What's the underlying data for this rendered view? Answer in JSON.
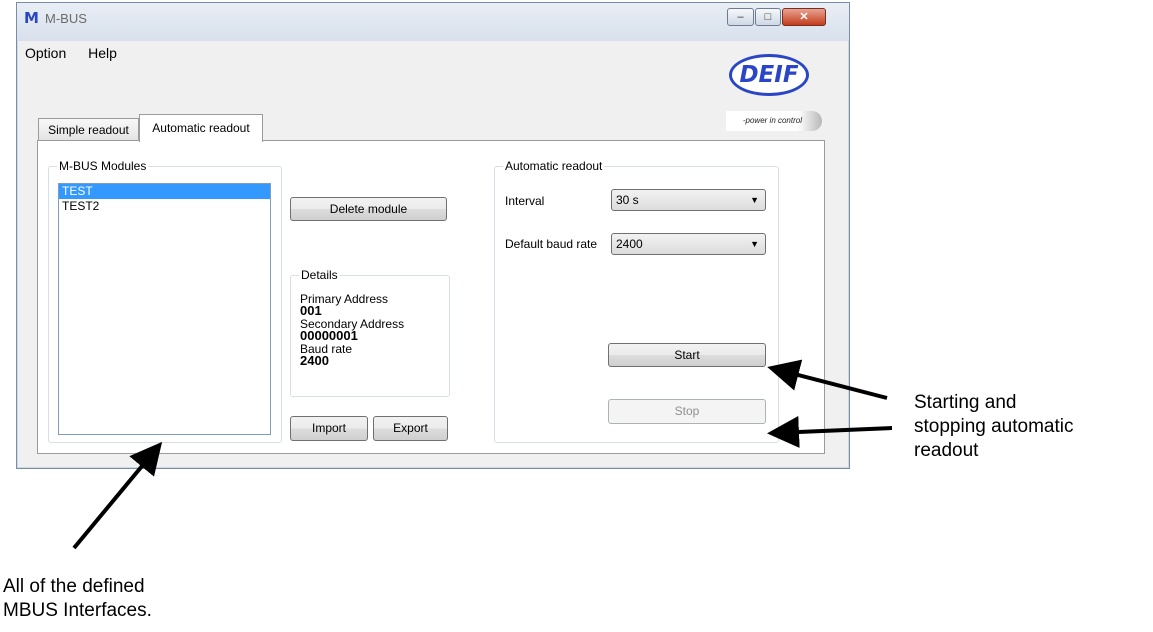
{
  "window": {
    "title": "M-BUS",
    "app_icon": "M",
    "controls": {
      "minimize": "–",
      "maximize": "□",
      "close": "✕"
    }
  },
  "menu": {
    "items": [
      "Option",
      "Help"
    ]
  },
  "logo": {
    "brand": "DEIF",
    "tagline": "-power in control"
  },
  "tabs": [
    {
      "label": "Simple readout",
      "active": false
    },
    {
      "label": "Automatic readout",
      "active": true
    }
  ],
  "modules": {
    "legend": "M-BUS Modules",
    "items": [
      {
        "label": "TEST",
        "selected": true
      },
      {
        "label": "TEST2",
        "selected": false
      }
    ]
  },
  "buttons": {
    "delete_module": "Delete module",
    "import": "Import",
    "export": "Export",
    "start": "Start",
    "stop": "Stop"
  },
  "details": {
    "legend": "Details",
    "primary_address_label": "Primary Address",
    "primary_address_value": "001",
    "secondary_address_label": "Secondary Address",
    "secondary_address_value": "00000001",
    "baud_rate_label": "Baud rate",
    "baud_rate_value": "2400"
  },
  "automatic": {
    "legend": "Automatic readout",
    "interval_label": "Interval",
    "interval_value": "30 s",
    "baud_label": "Default baud rate",
    "baud_value": "2400"
  },
  "annotations": {
    "start_stop_1": "Starting and",
    "start_stop_2": "stopping automatic",
    "start_stop_3": "readout",
    "interfaces_1": "All of the defined",
    "interfaces_2": "MBUS Interfaces."
  },
  "colors": {
    "selection": "#3399ff",
    "brand": "#2a46c7"
  }
}
